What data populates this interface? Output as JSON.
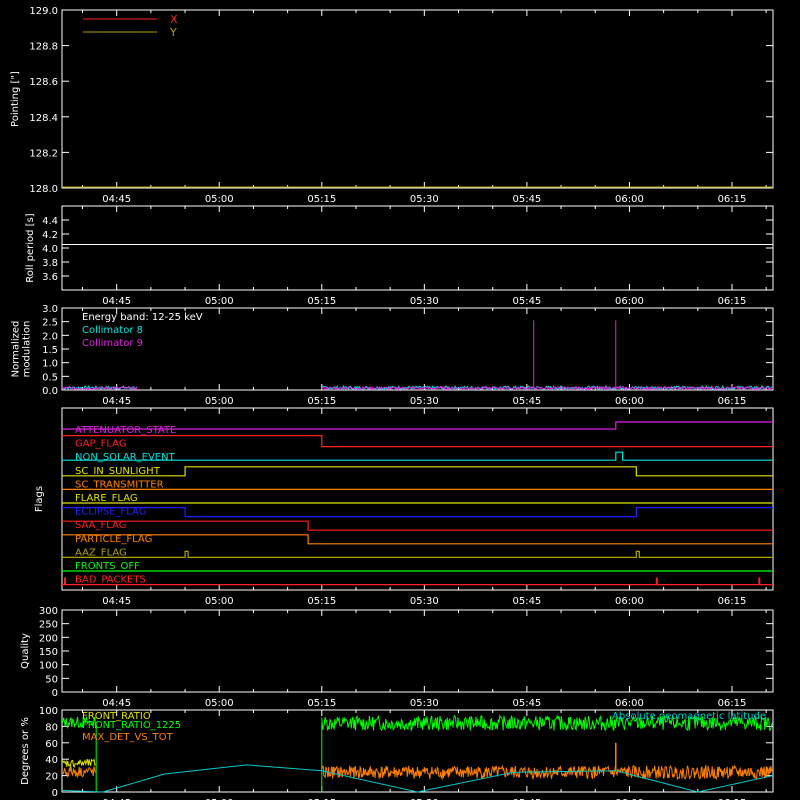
{
  "time_ticks": [
    "04:45",
    "05:00",
    "05:15",
    "05:30",
    "05:45",
    "06:00",
    "06:15"
  ],
  "colors": {
    "background": "#000000",
    "frame": "#ffffff",
    "x_pointing": "#ff2020",
    "y_pointing": "#b0a000",
    "collimator8": "#00e0e0",
    "collimator9": "#e020e0",
    "front_ratio": "#e0e000",
    "front_ratio_1225": "#00ff00",
    "max_det": "#ff8000",
    "geomag": "#00c8c8"
  },
  "chart_data": [
    {
      "type": "line",
      "ylabel": "Pointing [\"]",
      "ylim": [
        128.0,
        129.0
      ],
      "yticks": [
        "129.0",
        "128.8",
        "128.6",
        "128.4",
        "128.2",
        "128.0"
      ],
      "series": [
        {
          "name": "X",
          "values": []
        },
        {
          "name": "Y",
          "values": []
        }
      ]
    },
    {
      "type": "line",
      "ylabel": "Roll period [s]",
      "ylim": [
        3.4,
        4.6
      ],
      "yticks": [
        "4.4",
        "4.2",
        "4.0",
        "3.8",
        "3.6"
      ],
      "series": [
        {
          "values": [
            {
              "x": "04:37",
              "y": 4.05
            },
            {
              "x": "06:21",
              "y": 4.05
            }
          ]
        }
      ]
    },
    {
      "type": "line",
      "ylabel": "Normalized modulation",
      "ylabel_lines": [
        "Normalized",
        "modulation"
      ],
      "ylim": [
        0.0,
        3.0
      ],
      "yticks": [
        "3.0",
        "2.5",
        "2.0",
        "1.5",
        "1.0",
        "0.5",
        "0.0"
      ],
      "annotation": "Energy band: 12-25 keV",
      "series": [
        {
          "name": "Collimator 8",
          "note": "baseline ~0.05, data 04:37-04:48 and 05:15-06:21"
        },
        {
          "name": "Collimator 9",
          "spikes": [
            {
              "x": "05:46",
              "y": 2.55
            },
            {
              "x": "05:58",
              "y": 2.55
            }
          ]
        }
      ]
    },
    {
      "type": "line",
      "ylabel": "Flags",
      "flags": [
        {
          "label": "ATTENUATOR_STATE",
          "color": "#e020e0",
          "transitions": [
            {
              "x": "05:58",
              "state": "high"
            }
          ]
        },
        {
          "label": "GAP_FLAG",
          "color": "#ff2020",
          "transitions": [
            {
              "x": "05:15",
              "state": "low"
            }
          ]
        },
        {
          "label": "NON_SOLAR_EVENT",
          "color": "#00e0e0",
          "transitions": [
            {
              "x": "05:58",
              "state": "pulse_end",
              "end": "05:59"
            }
          ]
        },
        {
          "label": "SC_IN_SUNLIGHT",
          "color": "#e0e000",
          "transitions": [
            {
              "x": "04:55",
              "state": "high"
            },
            {
              "x": "06:01",
              "state": "low"
            }
          ]
        },
        {
          "label": "SC_TRANSMITTER",
          "color": "#ff8000",
          "transitions": []
        },
        {
          "label": "FLARE_FLAG",
          "color": "#e0e000",
          "transitions": []
        },
        {
          "label": "ECLIPSE_FLAG",
          "color": "#2020ff",
          "transitions": [
            {
              "x": "04:55",
              "state": "low"
            },
            {
              "x": "06:01",
              "state": "high"
            }
          ]
        },
        {
          "label": "SAA_FLAG",
          "color": "#ff2020",
          "transitions": [
            {
              "x": "05:13",
              "state": "low"
            }
          ]
        },
        {
          "label": "PARTICLE_FLAG",
          "color": "#ff8000",
          "transitions": [
            {
              "x": "05:13",
              "state": "low"
            }
          ]
        },
        {
          "label": "AAZ_FLAG",
          "color": "#b0a000",
          "transitions": [
            {
              "x": "04:55",
              "state": "pulse"
            },
            {
              "x": "06:01",
              "state": "pulse"
            }
          ]
        },
        {
          "label": "FRONTS_OFF",
          "color": "#00ff00",
          "transitions": []
        },
        {
          "label": "BAD_PACKETS",
          "color": "#ff2020",
          "transitions": [
            {
              "x": "04:37",
              "state": "pulse"
            },
            {
              "x": "06:04",
              "state": "pulse"
            },
            {
              "x": "06:19",
              "state": "pulse"
            }
          ]
        }
      ]
    },
    {
      "type": "line",
      "ylabel": "Quality",
      "ylim": [
        0,
        300
      ],
      "yticks": [
        "300",
        "250",
        "200",
        "150",
        "100",
        "50",
        "0"
      ],
      "series": [
        {
          "values": [
            {
              "x": "04:37",
              "y": 300
            },
            {
              "x": "06:21",
              "y": 300
            }
          ]
        }
      ]
    },
    {
      "type": "line",
      "ylabel": "Degrees or %",
      "ylim": [
        0,
        100
      ],
      "yticks": [
        "100",
        "80",
        "60",
        "40",
        "20",
        "0"
      ],
      "series": [
        {
          "name": "FRONT_RATIO",
          "note": "~35 during 04:37-04:42"
        },
        {
          "name": "FRONT_RATIO_1225",
          "note": "~85 during 04:37-04:42 and 05:15-06:21"
        },
        {
          "name": "MAX_DET_VS_TOT",
          "note": "~25 during 04:37-04:42 and 05:15-06:21, spike ~60 at 05:58"
        },
        {
          "name": "Absolute geomagnetic latitude",
          "values": [
            {
              "x": "04:37",
              "y": 2
            },
            {
              "x": "04:43",
              "y": 0
            },
            {
              "x": "04:52",
              "y": 22
            },
            {
              "x": "05:04",
              "y": 33
            },
            {
              "x": "05:15",
              "y": 26
            },
            {
              "x": "05:29",
              "y": 0
            },
            {
              "x": "05:43",
              "y": 24
            },
            {
              "x": "05:58",
              "y": 26
            },
            {
              "x": "06:10",
              "y": 0
            },
            {
              "x": "06:21",
              "y": 20
            }
          ]
        }
      ]
    }
  ]
}
